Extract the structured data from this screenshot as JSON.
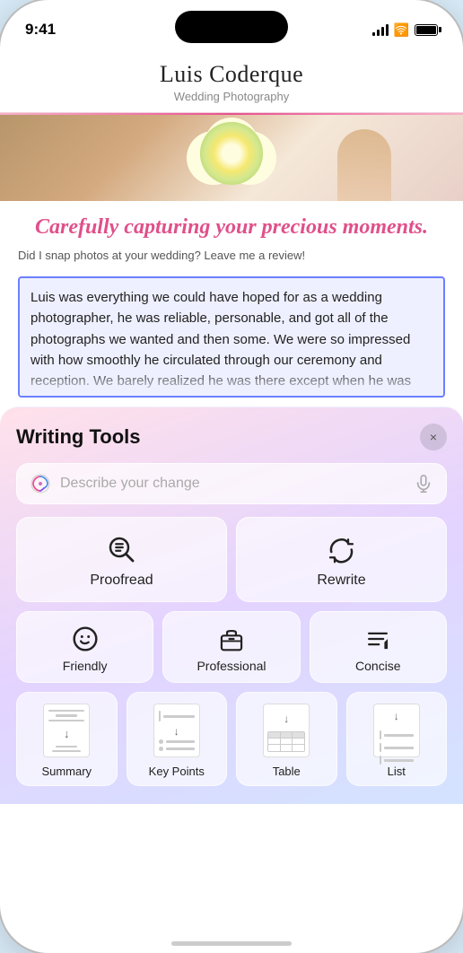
{
  "status": {
    "time": "9:41",
    "battery_full": true
  },
  "site": {
    "title": "Luis Coderque",
    "subtitle": "Wedding Photography",
    "tagline": "Carefully capturing your precious moments.",
    "review_prompt": "Did I snap photos at your wedding? Leave me a review!",
    "selected_text": "Luis was everything we could have hoped for as a wedding photographer, he was reliable, personable, and got all of the photographs we wanted and then some. We were so impressed with how smoothly he circulated through our ceremony and reception. We barely realized he was there except when he was very"
  },
  "writing_tools": {
    "title": "Writing Tools",
    "close_label": "×",
    "search_placeholder": "Describe your change",
    "buttons": {
      "proofread": "Proofread",
      "rewrite": "Rewrite",
      "friendly": "Friendly",
      "professional": "Professional",
      "concise": "Concise",
      "summary": "Summary",
      "key_points": "Key Points",
      "table": "Table",
      "list": "List"
    }
  }
}
